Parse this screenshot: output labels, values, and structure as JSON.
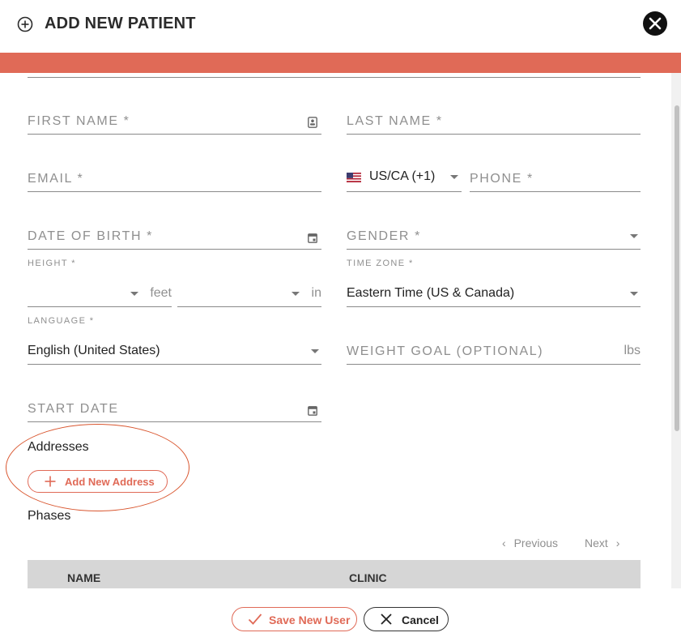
{
  "header": {
    "title": "ADD NEW PATIENT",
    "plus_icon": "plus-circle-icon",
    "close_icon": "close-icon"
  },
  "colors": {
    "accent": "#e06a57",
    "highlight_annotation": "#d9562f",
    "table_header_bg": "#d6d6d6"
  },
  "form": {
    "first_name": {
      "placeholder": "FIRST NAME *",
      "icon": "contact-card-icon"
    },
    "last_name": {
      "placeholder": "LAST NAME *"
    },
    "email": {
      "placeholder": "EMAIL *"
    },
    "phone_country": {
      "value": "US/CA (+1)",
      "icon": "us-flag-icon"
    },
    "phone": {
      "placeholder": "PHONE *"
    },
    "date_of_birth": {
      "placeholder": "DATE OF BIRTH *",
      "icon": "calendar-icon"
    },
    "gender": {
      "placeholder": "GENDER *"
    },
    "height": {
      "label": "HEIGHT *",
      "feet_suffix": "feet",
      "inches_suffix": "in"
    },
    "time_zone": {
      "label": "TIME ZONE *",
      "value": "Eastern Time (US & Canada)"
    },
    "language": {
      "label": "LANGUAGE *",
      "value": "English (United States)"
    },
    "weight_goal": {
      "placeholder": "WEIGHT GOAL (OPTIONAL)",
      "suffix": "lbs"
    },
    "start_date": {
      "placeholder": "START DATE",
      "icon": "calendar-icon"
    }
  },
  "addresses": {
    "label": "Addresses",
    "add_button": "Add New Address"
  },
  "phases": {
    "label": "Phases",
    "previous": "Previous",
    "next": "Next",
    "columns": [
      "NAME",
      "CLINIC"
    ]
  },
  "footer": {
    "save_label": "Save New User",
    "cancel_label": "Cancel"
  }
}
